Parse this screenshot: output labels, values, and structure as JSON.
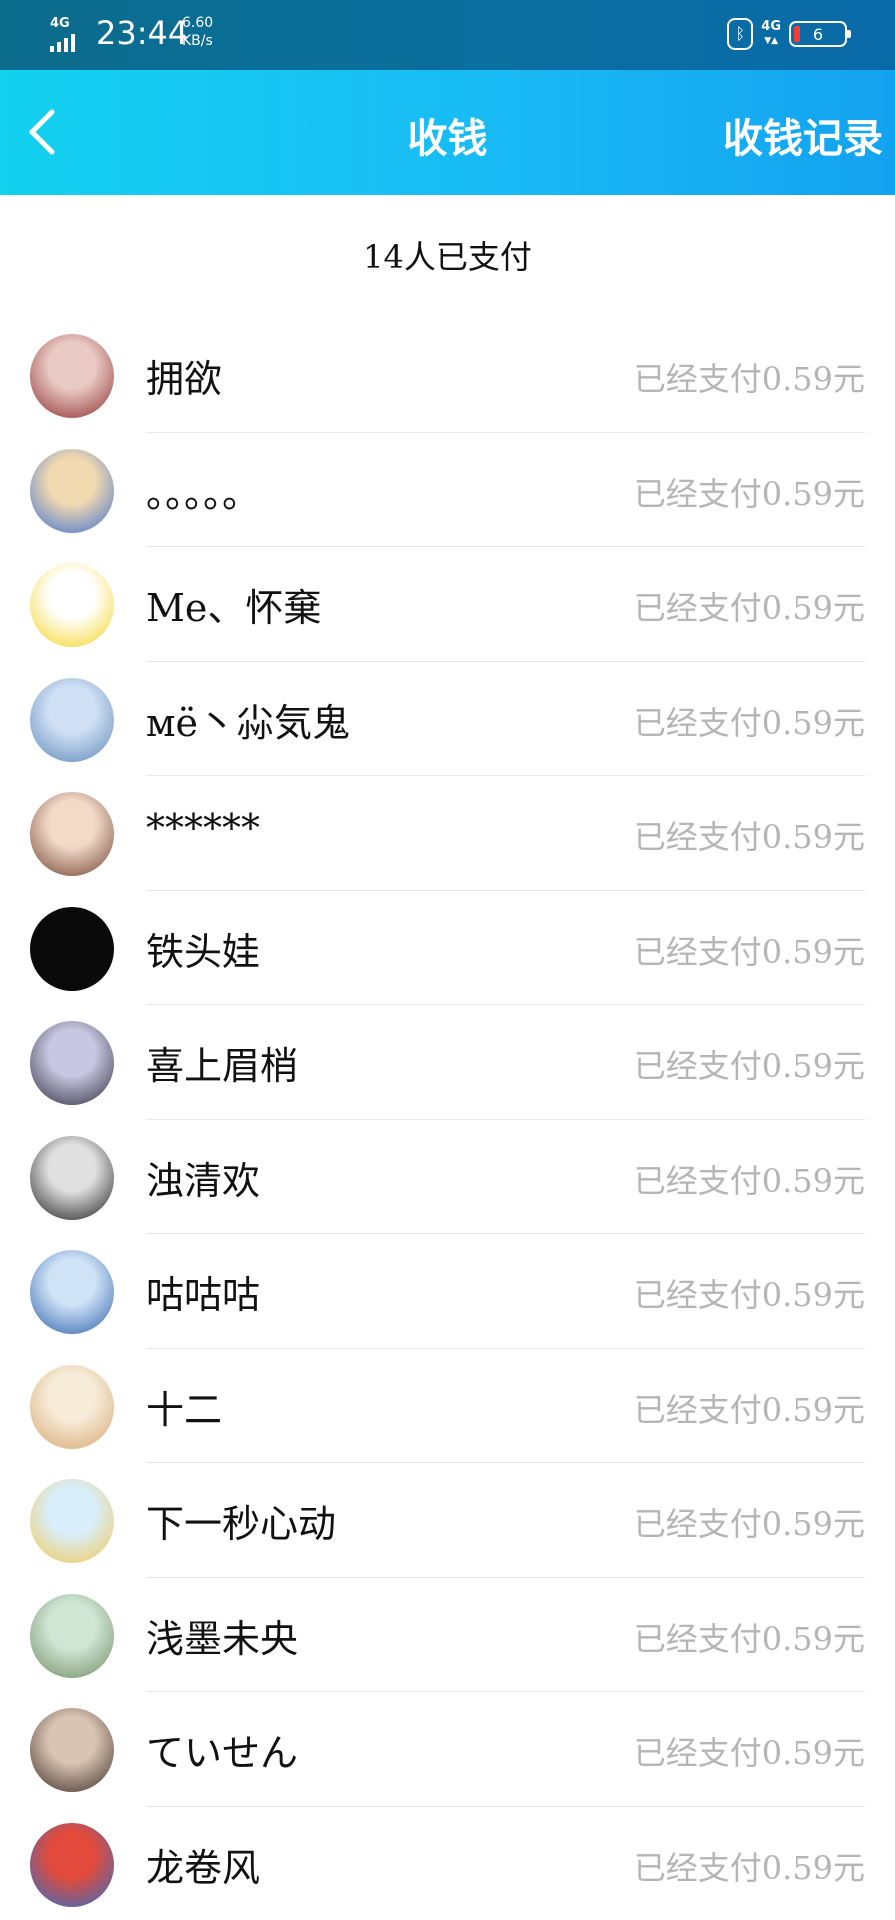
{
  "status_bar": {
    "network": "4G",
    "time": "23:44",
    "speed_value": "6.60",
    "speed_unit": "KB/s",
    "right_network": "4G",
    "battery": "6"
  },
  "header": {
    "title": "收钱",
    "records_label": "收钱记录"
  },
  "summary": {
    "paid_count": "14人已支付"
  },
  "payers": [
    {
      "name": "拥欲",
      "status": "已经支付0.59元",
      "avatar_colors": [
        "#e9c9c4",
        "#8a2c2c"
      ]
    },
    {
      "name": "。。。。。",
      "status": "已经支付0.59元",
      "avatar_colors": [
        "#f1d9b0",
        "#3a6fd1"
      ]
    },
    {
      "name": "Me、怀棄",
      "status": "已经支付0.59元",
      "avatar_colors": [
        "#ffffff",
        "#f4d21d"
      ]
    },
    {
      "name": "мё丶尛気鬼",
      "status": "已经支付0.59元",
      "avatar_colors": [
        "#cfe0f4",
        "#5d86b8"
      ]
    },
    {
      "name": "******",
      "status": "已经支付0.59元",
      "avatar_colors": [
        "#f3d9c8",
        "#6b3f2a"
      ]
    },
    {
      "name": "铁头娃",
      "status": "已经支付0.59元",
      "avatar_colors": [
        "#0a0a0a",
        "#0a0a0a"
      ]
    },
    {
      "name": "喜上眉梢",
      "status": "已经支付0.59元",
      "avatar_colors": [
        "#c8c6e0",
        "#2b2a3d"
      ]
    },
    {
      "name": "浊清欢",
      "status": "已经支付0.59元",
      "avatar_colors": [
        "#e0e0e0",
        "#1a1a1a"
      ]
    },
    {
      "name": "咕咕咕",
      "status": "已经支付0.59元",
      "avatar_colors": [
        "#cfe2f6",
        "#2a5faa"
      ]
    },
    {
      "name": "十二",
      "status": "已经支付0.59元",
      "avatar_colors": [
        "#f6ecd8",
        "#d7a46e"
      ]
    },
    {
      "name": "下一秒心动",
      "status": "已经支付0.59元",
      "avatar_colors": [
        "#d8eefb",
        "#f3c94f"
      ]
    },
    {
      "name": "浅墨未央",
      "status": "已经支付0.59元",
      "avatar_colors": [
        "#cfe6d4",
        "#6f8a62"
      ]
    },
    {
      "name": "ていせん",
      "status": "已经支付0.59元",
      "avatar_colors": [
        "#d9c3b2",
        "#3c2b25"
      ]
    },
    {
      "name": "龙卷风",
      "status": "已经支付0.59元",
      "avatar_colors": [
        "#e24a3b",
        "#2a6fc9"
      ]
    }
  ]
}
